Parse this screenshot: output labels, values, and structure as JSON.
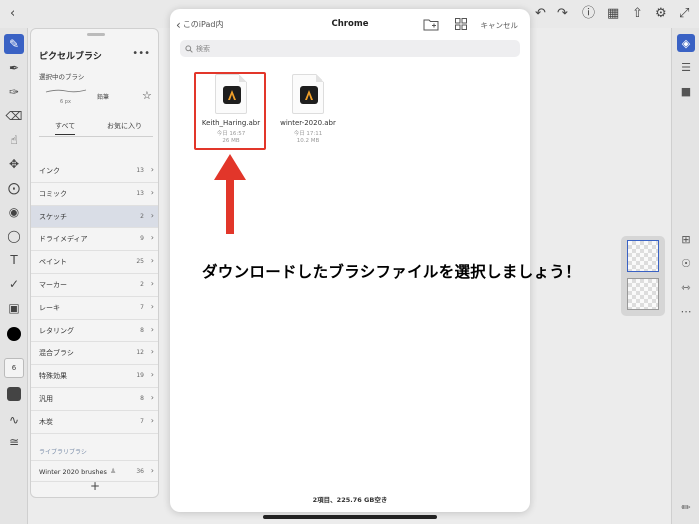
{
  "picker": {
    "back_label": "このiPad内",
    "title": "Chrome",
    "cancel_label": "キャンセル",
    "search_placeholder": "検索",
    "files": [
      {
        "name": "Keith_Haring.abr",
        "date": "今日 16:57",
        "size": "26 MB",
        "highlighted": true
      },
      {
        "name": "winter-2020.abr",
        "date": "今日 17:11",
        "size": "10.2 MB",
        "highlighted": false
      }
    ],
    "footer": "2項目、225.76 GB空き"
  },
  "annotation": {
    "caption": "ダウンロードしたブラシファイルを選択しましょう！",
    "color": "#e2362a"
  },
  "brush_panel": {
    "title": "ピクセルブラシ",
    "current_label": "選択中のブラシ",
    "current_size": "6 px",
    "current_name": "鉛筆",
    "tabs": [
      "すべて",
      "お気に入り"
    ],
    "categories": [
      {
        "name": "インク",
        "count": "13"
      },
      {
        "name": "コミック",
        "count": "13"
      },
      {
        "name": "スケッチ",
        "count": "2",
        "selected": true
      },
      {
        "name": "ドライメディア",
        "count": "9"
      },
      {
        "name": "ペイント",
        "count": "25"
      },
      {
        "name": "マーカー",
        "count": "2"
      },
      {
        "name": "レーキ",
        "count": "7"
      },
      {
        "name": "レタリング",
        "count": "8"
      },
      {
        "name": "混合ブラシ",
        "count": "12"
      },
      {
        "name": "特殊効果",
        "count": "19"
      },
      {
        "name": "汎用",
        "count": "8"
      },
      {
        "name": "木炭",
        "count": "7"
      }
    ],
    "library_label": "ライブラリブラシ",
    "library_items": [
      {
        "name": "Winter 2020 brushes",
        "count": "36"
      }
    ]
  },
  "toolbar": {
    "brush_size": "6"
  },
  "colors": {
    "accent": "#3a62c4",
    "current_color": "#000000"
  }
}
